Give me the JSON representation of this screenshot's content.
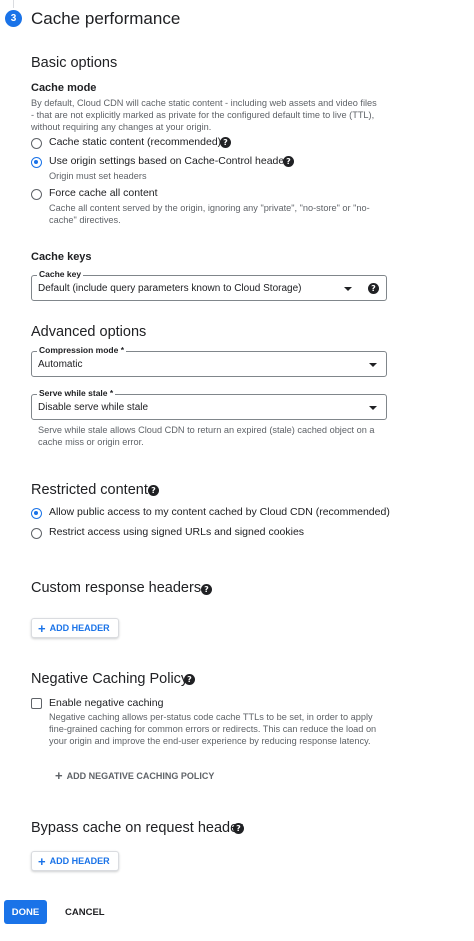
{
  "step": {
    "number": "3",
    "title": "Cache performance"
  },
  "basic_options": {
    "heading": "Basic options",
    "cache_mode": {
      "heading": "Cache mode",
      "description": "By default, Cloud CDN will cache static content - including web assets and video files - that are not explicitly marked as private for the configured default time to live (TTL), without requiring any changes at your origin.",
      "options": [
        {
          "label": "Cache static content (recommended)",
          "selected": false,
          "has_help": true,
          "sub": ""
        },
        {
          "label": "Use origin settings based on Cache-Control headers",
          "selected": true,
          "has_help": true,
          "sub": "Origin must set headers"
        },
        {
          "label": "Force cache all content",
          "selected": false,
          "has_help": false,
          "sub": "Cache all content served by the origin, ignoring any \"private\", \"no-store\" or \"no-cache\" directives."
        }
      ]
    }
  },
  "cache_keys": {
    "heading": "Cache keys",
    "field_label": "Cache key",
    "field_value": "Default (include query parameters known to Cloud Storage)"
  },
  "advanced_options": {
    "heading": "Advanced options",
    "compression": {
      "label": "Compression mode *",
      "value": "Automatic"
    },
    "serve_while_stale": {
      "label": "Serve while stale *",
      "value": "Disable serve while stale",
      "hint": "Serve while stale allows Cloud CDN to return an expired (stale) cached object on a cache miss or origin error."
    }
  },
  "restricted_content": {
    "heading": "Restricted content",
    "options": [
      {
        "label": "Allow public access to my content cached by Cloud CDN (recommended)",
        "selected": true
      },
      {
        "label": "Restrict access using signed URLs and signed cookies",
        "selected": false
      }
    ]
  },
  "custom_response_headers": {
    "heading": "Custom response headers",
    "add_label": "ADD HEADER"
  },
  "negative_caching": {
    "heading": "Negative Caching Policy",
    "checkbox_label": "Enable negative caching",
    "checked": false,
    "description": "Negative caching allows per-status code cache TTLs to be set, in order to apply fine-grained caching for common errors or redirects. This can reduce the load on your origin and improve the end-user experience by reducing response latency.",
    "add_policy_label": "ADD NEGATIVE CACHING POLICY"
  },
  "bypass_cache": {
    "heading": "Bypass cache on request header",
    "add_label": "ADD HEADER"
  },
  "footer": {
    "done_label": "DONE",
    "cancel_label": "CANCEL"
  },
  "colors": {
    "accent": "#1a73e8",
    "text": "#202124",
    "secondary_text": "#5f6368",
    "border": "#80868b"
  },
  "icons": {
    "help": "help-icon",
    "dropdown": "chevron-down-icon",
    "add": "plus-icon"
  }
}
